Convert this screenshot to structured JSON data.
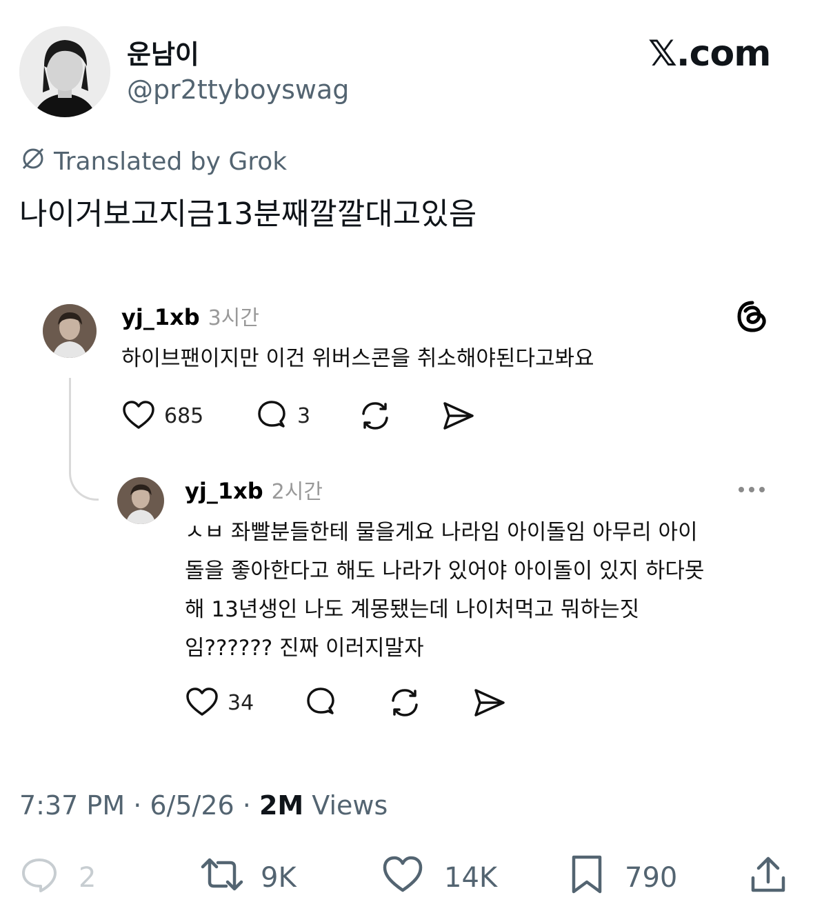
{
  "author": {
    "display_name": "운남이",
    "handle": "@pr2ttyboyswag"
  },
  "brand": "𝕏.com",
  "translated_label": "Translated by Grok",
  "tweet_text": "나이거보고지금13분째깔깔대고있음",
  "embedded_threads": {
    "post1": {
      "username": "yj_1xb",
      "time": "3시간",
      "text": "하이브팬이지만 이건 위버스콘을 취소해야된다고봐요",
      "likes": "685",
      "replies": "3"
    },
    "post2": {
      "username": "yj_1xb",
      "time": "2시간",
      "text_lines": [
        "ㅅㅂ 좌빨분들한테 물을게요 나라임 아이돌임 아무리 아이",
        "돌을 좋아한다고 해도 나라가 있어야 아이돌이 있지 하다못",
        "해 13년생인 나도 계몽됐는데 나이처먹고 뭐하는짓",
        "임?????? 진짜 이러지말자"
      ],
      "likes": "34"
    }
  },
  "meta": {
    "time": "7:37 PM",
    "sep1": " · ",
    "date": "6/5/26",
    "sep2": " · ",
    "views_count": "2M",
    "views_label": " Views"
  },
  "actions": {
    "replies": "2",
    "reposts": "9K",
    "likes": "14K",
    "bookmarks": "790"
  }
}
